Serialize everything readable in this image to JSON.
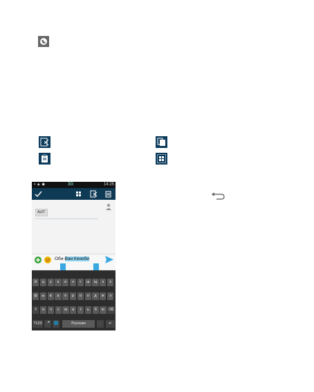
{
  "icons": {
    "globe": "globe-icon",
    "cut": "cut-icon",
    "copy": "copy-icon",
    "paste": "paste-icon",
    "select_all": "select-all-icon",
    "back": "back-arrow-icon"
  },
  "phone": {
    "status": {
      "time": "14:25",
      "network": "3G"
    },
    "recipient_chip": "Ар2Г",
    "message": {
      "before": "Оби-",
      "selected": "Ван Кеноби"
    },
    "keyboard": {
      "row1": [
        "й",
        "ц",
        "у",
        "к",
        "е",
        "н",
        "г",
        "ш",
        "щ",
        "з",
        "х"
      ],
      "row2": [
        "ф",
        "ы",
        "в",
        "а",
        "п",
        "р",
        "о",
        "л",
        "д",
        "ж",
        "э"
      ],
      "row3": [
        "я",
        "ч",
        "с",
        "м",
        "и",
        "т",
        "ь",
        "б",
        "ю"
      ],
      "row4": {
        "sym": "?123",
        "space": "Русская",
        "period": ".",
        "enter": "↵"
      }
    },
    "colors": {
      "action_bar": "#0f3a55",
      "selection": "#8fd3f0",
      "handle": "#39a7e0"
    }
  }
}
